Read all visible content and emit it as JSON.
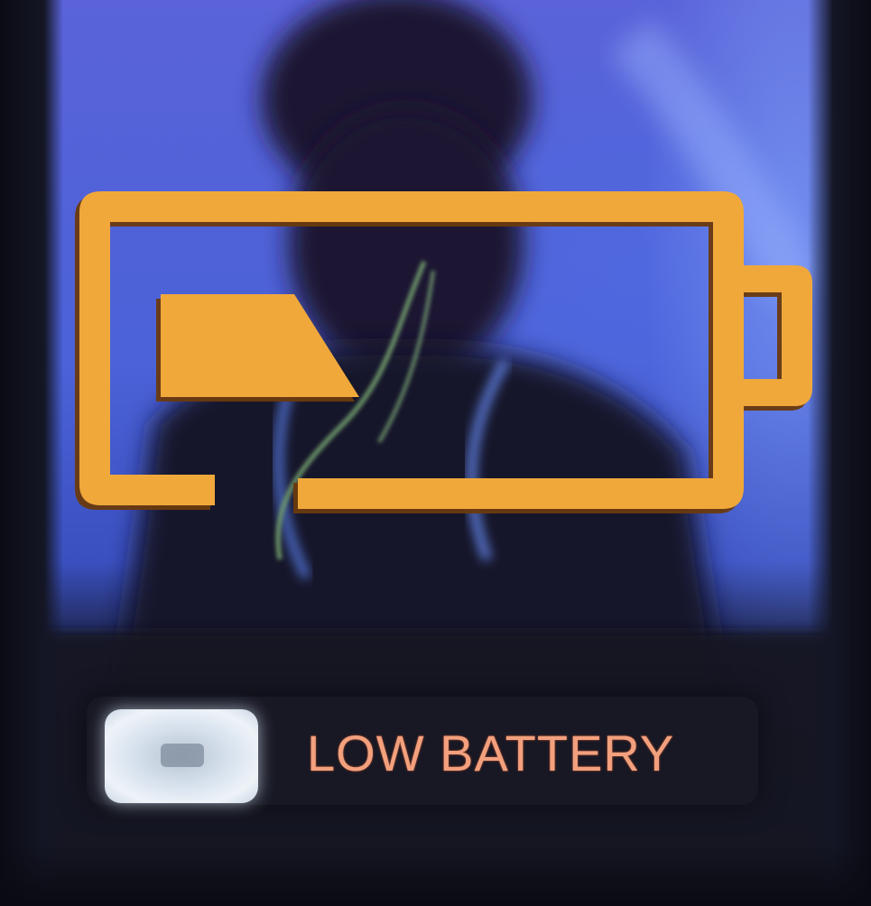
{
  "notification": {
    "label": "LOW BATTERY",
    "icon": "low-battery-icon",
    "battery_level": 0.3,
    "accent_color": "#f0a83a",
    "text_color": "#f2a07d"
  },
  "background": {
    "description_icon": "photo-background"
  }
}
